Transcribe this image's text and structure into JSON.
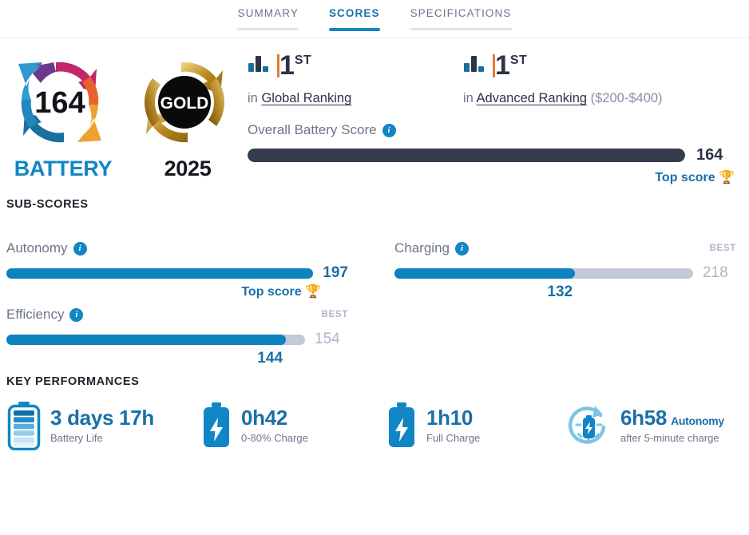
{
  "tabs": [
    {
      "label": "SUMMARY",
      "active": false
    },
    {
      "label": "SCORES",
      "active": true
    },
    {
      "label": "SPECIFICATIONS",
      "active": false
    }
  ],
  "badges": {
    "score_badge": {
      "value": "164",
      "label": "BATTERY",
      "icon": "circular-arrows-logo"
    },
    "award_badge": {
      "value": "GOLD",
      "label": "2025",
      "icon": "gold-award-logo"
    }
  },
  "rankings": [
    {
      "rank": "1",
      "rank_suffix": "ST",
      "prefix": "in",
      "link": "Global Ranking",
      "paren": "",
      "icon": "bar-chart-icon"
    },
    {
      "rank": "1",
      "rank_suffix": "ST",
      "prefix": "in",
      "link": "Advanced Ranking",
      "paren": "($200-$400)",
      "icon": "bar-chart-icon"
    }
  ],
  "overall": {
    "label": "Overall Battery Score",
    "value": "164",
    "fill_percent": 100,
    "top_score_label": "Top score",
    "bar_color": "#343c4e"
  },
  "sections": {
    "subscores_title": "SUB-SCORES",
    "key_performances_title": "KEY PERFORMANCES"
  },
  "subscores": [
    {
      "label": "Autonomy",
      "value": "197",
      "fill_percent": 100,
      "best_caption": "",
      "best_value": "",
      "top_score_label": "Top score",
      "has_top_score": true
    },
    {
      "label": "Charging",
      "value": "132",
      "fill_percent": 60.5,
      "best_caption": "BEST",
      "best_value": "218",
      "top_score_label": "",
      "has_top_score": false
    },
    {
      "label": "Efficiency",
      "value": "144",
      "fill_percent": 93.5,
      "best_caption": "BEST",
      "best_value": "154",
      "top_score_label": "",
      "has_top_score": false
    }
  ],
  "key_performances": [
    {
      "value": "3 days 17h",
      "suffix": "",
      "caption": "Battery Life",
      "icon": "battery-level-icon"
    },
    {
      "value": "0h42",
      "suffix": "",
      "caption": "0-80% Charge",
      "icon": "battery-bolt-icon"
    },
    {
      "value": "1h10",
      "suffix": "",
      "caption": "Full Charge",
      "icon": "battery-bolt-icon"
    },
    {
      "value": "6h58",
      "suffix": "Autonomy",
      "caption": "after 5-minute charge",
      "icon": "quick-charge-icon"
    }
  ],
  "colors": {
    "accent_blue": "#1186c4",
    "link_blue": "#1b6fa8",
    "dark_navy": "#343c4e",
    "muted_gray": "#6d7589",
    "best_gray": "#aeb5c9",
    "gold": "#f5b940",
    "orange": "#e8792e"
  },
  "info_icon_glyph": "i",
  "trophy_glyph": "🏆"
}
